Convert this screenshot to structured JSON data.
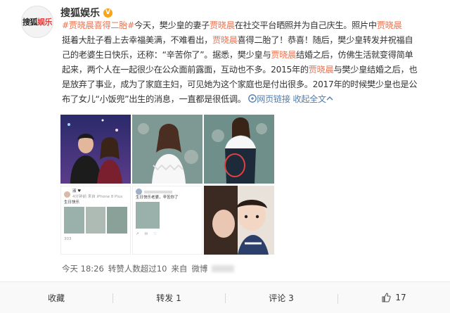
{
  "account": {
    "avatar_text_a": "搜狐",
    "avatar_text_b": "娱乐",
    "name": "搜狐娱乐",
    "verified_icon": "v-badge-icon"
  },
  "post": {
    "hashtag": "#贾晓晨喜得二胎#",
    "line1": "今天，樊少皇的妻子",
    "name1": "贾晓晨",
    "line1b": "在社交平台晒照并为自己庆生。照片中",
    "name2": "贾晓晨",
    "line2": "挺着大肚子看上去幸福美满，不难看出，",
    "name3": "贾晓晨",
    "line2b": "喜得二胎了！恭喜！随后，樊少皇转发并祝福自",
    "line3": "己的老婆生日快乐，还称：“辛苦你了”。据悉，樊少皇与",
    "name4": "贾晓晨",
    "line3b": "结婚之后，仿佛生活就变得简单",
    "line4": "起来，两个人在一起很少在公众面前露面，互动也不多。2015年的",
    "name5": "贾晓晨",
    "line4b": "与樊少皇结婚之后，也",
    "line5": "是放弃了事业，成为了家庭主妇，可见她为这个家庭也是付出很多。2017年的时候樊少皇也是公",
    "line6": "布了女儿“小饭兜”出生的消息，一直都是很低调。",
    "web_link": "网页链接",
    "collapse": "收起全文",
    "collapse_icon": "caret-up-icon",
    "link_icon": "link-icon"
  },
  "screenshot": {
    "user": "淑 ♥",
    "meta": "4分钟前 来自 iPhone 8 Plus",
    "text": "生日快乐",
    "likes": "303",
    "comment_text": "生日快乐老婆，辛苦你了"
  },
  "meta": {
    "time": "今天 18:26",
    "reposts": "转赞人数超过10",
    "source_prefix": "来自",
    "source": "微博"
  },
  "actions": [
    {
      "label": "收藏"
    },
    {
      "label": "转发 1"
    },
    {
      "label": "评论 3"
    },
    {
      "label": "17"
    }
  ],
  "colors": {
    "accent": "#eb7350",
    "link": "#507daf"
  }
}
